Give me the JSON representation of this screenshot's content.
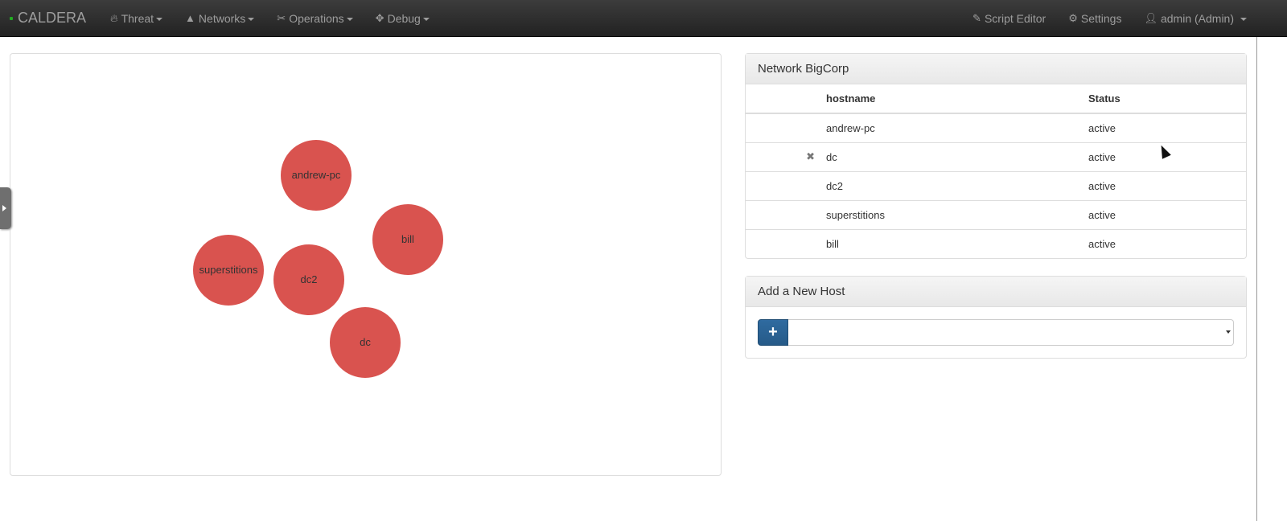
{
  "navbar": {
    "brand": "CALDERA",
    "menus": [
      {
        "label": "Threat",
        "icon": "fire-icon"
      },
      {
        "label": "Networks",
        "icon": "road-icon"
      },
      {
        "label": "Operations",
        "icon": "scissors-icon"
      },
      {
        "label": "Debug",
        "icon": "move-icon"
      }
    ],
    "script_editor": "Script Editor",
    "settings": "Settings",
    "user": "admin (Admin)"
  },
  "graph": {
    "node_color": "#d9534f",
    "nodes": [
      "andrew-pc",
      "bill",
      "superstitions",
      "dc2",
      "dc"
    ]
  },
  "network_panel": {
    "title": "Network BigCorp",
    "columns": [
      "hostname",
      "Status"
    ],
    "rows": [
      {
        "hostname": "andrew-pc",
        "status": "active",
        "remove_icon": false
      },
      {
        "hostname": "dc",
        "status": "active",
        "remove_icon": true
      },
      {
        "hostname": "dc2",
        "status": "active",
        "remove_icon": false
      },
      {
        "hostname": "superstitions",
        "status": "active",
        "remove_icon": false
      },
      {
        "hostname": "bill",
        "status": "active",
        "remove_icon": false
      }
    ]
  },
  "add_host_panel": {
    "title": "Add a New Host",
    "add_button": "+",
    "accent": "#286090"
  }
}
